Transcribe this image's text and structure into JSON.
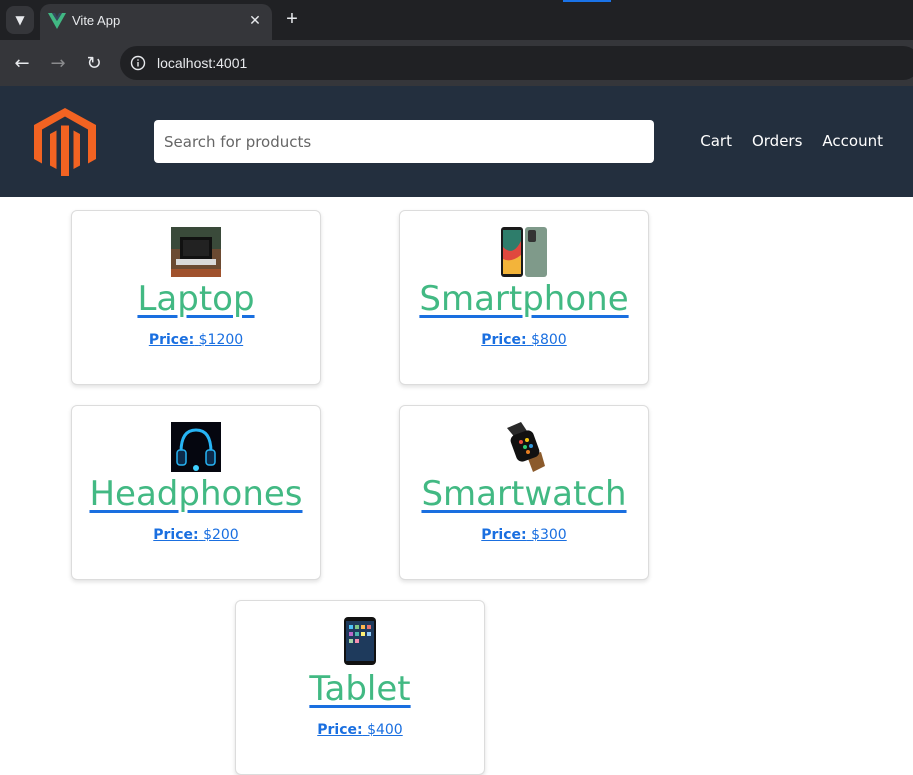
{
  "browser": {
    "tab_title": "Vite App",
    "url": "localhost:4001"
  },
  "header": {
    "search_placeholder": "Search for products",
    "nav": [
      "Cart",
      "Orders",
      "Account"
    ]
  },
  "price_label": "Price:",
  "products": [
    {
      "name": "Laptop",
      "price": "$1200",
      "image_icon": "laptop-image"
    },
    {
      "name": "Smartphone",
      "price": "$800",
      "image_icon": "smartphone-image"
    },
    {
      "name": "Headphones",
      "price": "$200",
      "image_icon": "headphones-image"
    },
    {
      "name": "Smartwatch",
      "price": "$300",
      "image_icon": "smartwatch-image"
    },
    {
      "name": "Tablet",
      "price": "$400",
      "image_icon": "tablet-image"
    }
  ],
  "colors": {
    "header_bg": "#232f3e",
    "logo": "#f26322",
    "product_name": "#42b983",
    "link": "#1a6fe0"
  }
}
